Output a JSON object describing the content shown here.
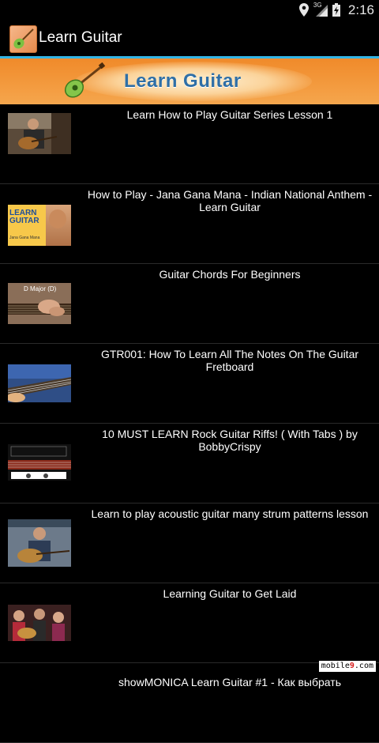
{
  "status_bar": {
    "time": "2:16",
    "network": "3G"
  },
  "action_bar": {
    "title": "Learn Guitar"
  },
  "banner": {
    "text": "Learn Guitar"
  },
  "videos": [
    {
      "title": "Learn How to Play Guitar Series Lesson 1"
    },
    {
      "title": "How to Play - Jana Gana Mana - Indian National Anthem - Learn Guitar",
      "thumb_text": "LEARN GUITAR",
      "thumb_sub": "Jana Gana Mana"
    },
    {
      "title": "Guitar Chords For Beginners",
      "thumb_text": "D Major (D)"
    },
    {
      "title": "GTR001: How To Learn All The Notes On The Guitar Fretboard"
    },
    {
      "title": "10 MUST LEARN Rock Guitar Riffs! ( With Tabs ) by BobbyCrispy"
    },
    {
      "title": "Learn to play acoustic guitar many strum patterns lesson"
    },
    {
      "title": "Learning Guitar to Get Laid"
    },
    {
      "title": "showMONICA Learn Guitar #1 - Как выбрать"
    }
  ],
  "watermark": {
    "prefix": "mobile",
    "accent": "9",
    "suffix": ".com"
  }
}
